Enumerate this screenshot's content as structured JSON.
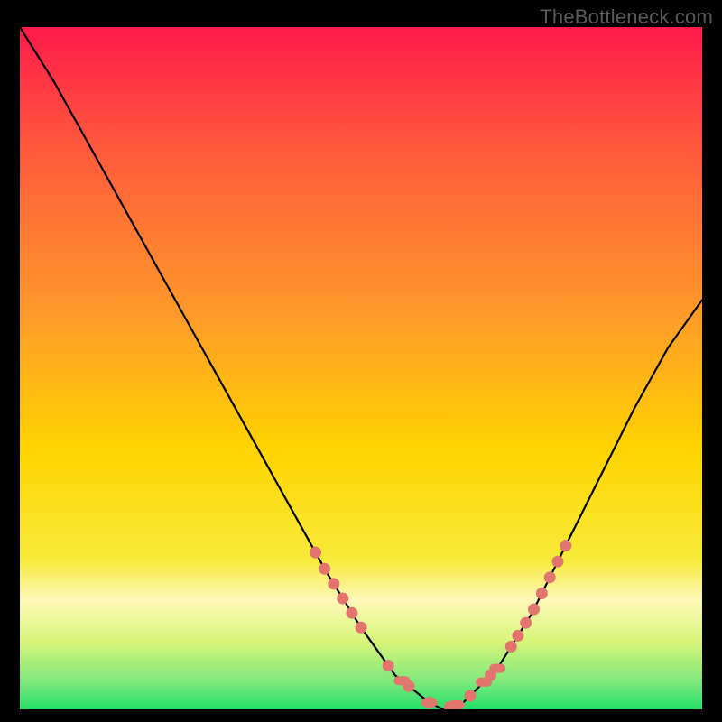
{
  "watermark": "TheBottleneck.com",
  "chart_data": {
    "type": "line",
    "title": "",
    "xlabel": "",
    "ylabel": "",
    "xlim": [
      0,
      100
    ],
    "ylim": [
      0,
      100
    ],
    "x": [
      0,
      5,
      10,
      15,
      20,
      25,
      30,
      35,
      40,
      45,
      50,
      55,
      60,
      62,
      65,
      70,
      75,
      80,
      85,
      90,
      95,
      100
    ],
    "values": [
      100,
      92,
      83,
      74,
      65,
      56,
      47,
      38,
      29,
      20,
      12,
      5,
      1,
      0,
      1,
      6,
      14,
      24,
      34,
      44,
      53,
      60
    ],
    "highlight_band": {
      "y_from": 0,
      "y_to": 22,
      "description": "green-to-yellow safe zone near bottom"
    },
    "marker_ranges": [
      {
        "x_from": 42,
        "x_to": 50,
        "side": "left"
      },
      {
        "x_from": 54,
        "x_to": 72,
        "side": "bottom"
      },
      {
        "x_from": 73,
        "x_to": 80,
        "side": "right"
      }
    ],
    "colors": {
      "gradient_top": "#ff1a4a",
      "gradient_mid": "#ffd400",
      "gradient_low": "#fff04a",
      "gradient_band_pale": "#fdf8b8",
      "gradient_bottom": "#24e06a",
      "curve": "#000000",
      "marker": "#e2766f"
    }
  }
}
